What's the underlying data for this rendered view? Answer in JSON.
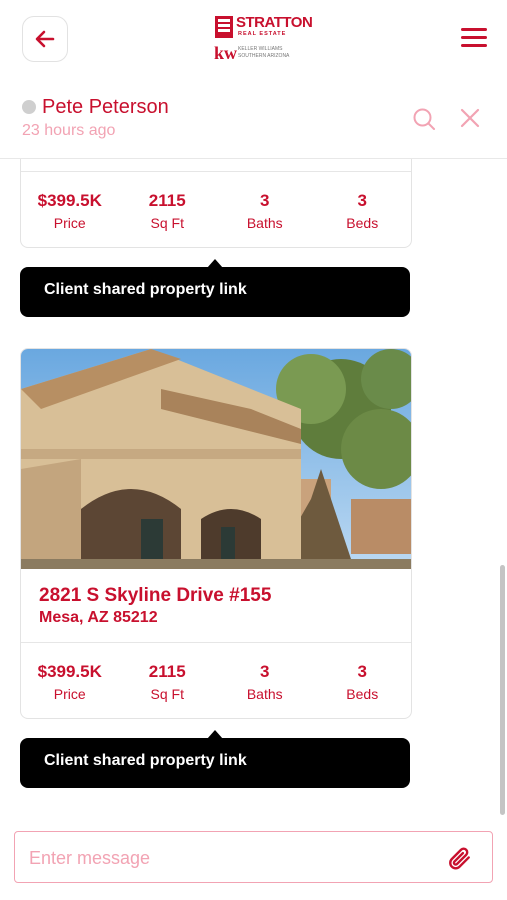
{
  "header": {
    "logo": {
      "word": "STRATTON",
      "sub": "REAL ESTATE",
      "kw": "kw",
      "kw_text": "KELLER WILLIAMS SOUTHERN ARIZONA"
    }
  },
  "chat": {
    "contact_name": "Pete Peterson",
    "last_seen": "23 hours ago"
  },
  "colors": {
    "accent": "#c8102e",
    "accent_light": "#f2a3b3",
    "banner_bg": "#000000"
  },
  "messages": [
    {
      "stats": [
        {
          "value": "$399.5K",
          "label": "Price"
        },
        {
          "value": "2115",
          "label": "Sq Ft"
        },
        {
          "value": "3",
          "label": "Baths"
        },
        {
          "value": "3",
          "label": "Beds"
        }
      ],
      "banner": "Client shared property link"
    },
    {
      "address": "2821 S Skyline Drive #155",
      "city": "Mesa, AZ 85212",
      "stats": [
        {
          "value": "$399.5K",
          "label": "Price"
        },
        {
          "value": "2115",
          "label": "Sq Ft"
        },
        {
          "value": "3",
          "label": "Baths"
        },
        {
          "value": "3",
          "label": "Beds"
        }
      ],
      "banner": "Client shared property link"
    }
  ],
  "composer": {
    "placeholder": "Enter message"
  },
  "icons": {
    "back": "arrow-left-icon",
    "menu": "hamburger-icon",
    "search": "search-icon",
    "close": "close-icon",
    "attach": "paperclip-icon"
  }
}
